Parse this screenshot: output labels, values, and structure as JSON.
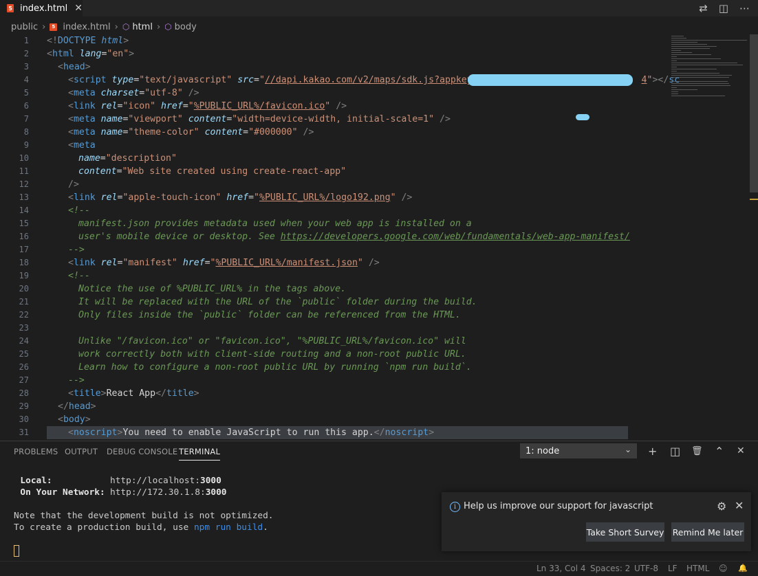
{
  "tab": {
    "filename": "index.html",
    "badge": "5",
    "close": "✕"
  },
  "tab_actions": {
    "compare": "⇄",
    "split": "◫",
    "more": "⋯"
  },
  "breadcrumb": {
    "folder": "public",
    "file": "index.html",
    "node1": "html",
    "node2": "body"
  },
  "editor": {
    "line_numbers": [
      "1",
      "2",
      "3",
      "4",
      "5",
      "6",
      "7",
      "8",
      "9",
      "10",
      "11",
      "12",
      "13",
      "14",
      "15",
      "16",
      "17",
      "18",
      "19",
      "20",
      "21",
      "22",
      "23",
      "24",
      "25",
      "26",
      "27",
      "28",
      "29",
      "30",
      "31"
    ],
    "script_src": "//dapi.kakao.com/v2/maps/sdk.js?appkey=6",
    "script_src_tail": "4",
    "meta_charset": "\"utf-8\"",
    "favicon": "%PUBLIC_URL%/favicon.ico",
    "viewport": "\"width=device-width, initial-scale=1\"",
    "theme_color": "\"#000000\"",
    "desc_name": "\"description\"",
    "desc_content": "\"Web site created using create-react-app\"",
    "logo": "%PUBLIC_URL%/logo192.png",
    "comment1_l1": "manifest.json provides metadata used when your web app is installed on a",
    "comment1_l2a": "user's mobile device or desktop. See ",
    "comment1_link": "https://developers.google.com/web/fundamentals/web-app-manifest/",
    "manifest": "%PUBLIC_URL%/manifest.json",
    "comment2_l1": "Notice the use of %PUBLIC_URL% in the tags above.",
    "comment2_l2": "It will be replaced with the URL of the `public` folder during the build.",
    "comment2_l3": "Only files inside the `public` folder can be referenced from the HTML.",
    "comment2_l4": "Unlike \"/favicon.ico\" or \"favicon.ico\", \"%PUBLIC_URL%/favicon.ico\" will",
    "comment2_l5": "work correctly both with client-side routing and a non-root public URL.",
    "comment2_l6": "Learn how to configure a non-root public URL by running `npm run build`.",
    "title_text": "React App",
    "noscript_text": "You need to enable JavaScript to run this app."
  },
  "panel": {
    "tabs": [
      "PROBLEMS",
      "OUTPUT",
      "DEBUG CONSOLE",
      "TERMINAL"
    ],
    "active_tab": "TERMINAL",
    "terminal_select": "1: node",
    "chevron": "⌄",
    "icons": {
      "add": "+",
      "split": "◫",
      "trash": "🗑",
      "maximize": "⌃",
      "close": "✕"
    }
  },
  "terminal": {
    "local_label": "  Local:",
    "local_url_base": "http://localhost:",
    "local_port": "3000",
    "network_label": "  On Your Network:",
    "network_url_base": "http://172.30.1.8:",
    "network_port": "3000",
    "note1": "Note that the development build is not optimized.",
    "note2a": "To create a production build, use ",
    "note2_cmd": "npm run build",
    "note2b": "."
  },
  "notification": {
    "message": "Help us improve our support for javascript",
    "survey_button": "Take Short Survey",
    "remind_button": "Remind Me later",
    "info": "i",
    "gear": "⚙",
    "close": "✕"
  },
  "statusbar": {
    "position": "Ln 33, Col 4",
    "spaces": "Spaces: 2",
    "encoding": "UTF-8",
    "eol": "LF",
    "language": "HTML",
    "feedback": "☺",
    "bell": "🔔"
  },
  "colors": {
    "background": "#1e1e1e",
    "tag": "#569cd6",
    "attr": "#9cdcfe",
    "string": "#ce9178",
    "comment": "#6a9955",
    "redaction": "#86d2f5"
  }
}
